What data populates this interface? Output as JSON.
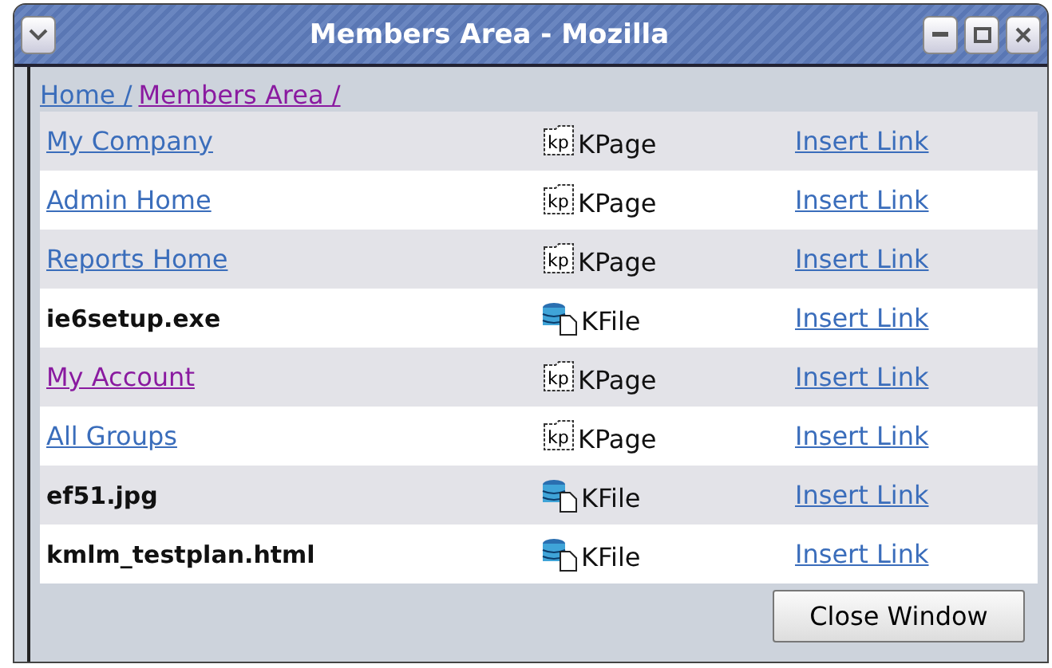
{
  "window": {
    "title": "Members Area - Mozilla"
  },
  "breadcrumb": [
    {
      "label": "Home /",
      "visited": false
    },
    {
      "label": "Members Area /",
      "visited": true
    }
  ],
  "rows": [
    {
      "kind": "page",
      "name": "My Company",
      "visited": false,
      "icon_label": "kp",
      "type": "KPage",
      "action": "Insert Link"
    },
    {
      "kind": "page",
      "name": "Admin Home",
      "visited": false,
      "icon_label": "kp",
      "type": "KPage",
      "action": "Insert Link"
    },
    {
      "kind": "page",
      "name": "Reports Home",
      "visited": false,
      "icon_label": "kp",
      "type": "KPage",
      "action": "Insert Link"
    },
    {
      "kind": "file",
      "name": "ie6setup.exe",
      "type": "KFile",
      "action": "Insert Link"
    },
    {
      "kind": "page",
      "name": "My Account",
      "visited": true,
      "icon_label": "kp",
      "type": "KPage",
      "action": "Insert Link"
    },
    {
      "kind": "page",
      "name": "All Groups",
      "visited": false,
      "icon_label": "kp",
      "type": "KPage",
      "action": "Insert Link"
    },
    {
      "kind": "file",
      "name": "ef51.jpg",
      "type": "KFile",
      "action": "Insert Link"
    },
    {
      "kind": "file",
      "name": "kmlm_testplan.html",
      "type": "KFile",
      "action": "Insert Link"
    }
  ],
  "close_button": "Close Window"
}
